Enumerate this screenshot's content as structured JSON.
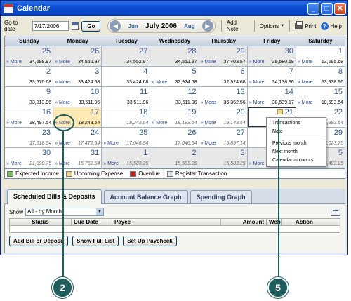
{
  "window": {
    "title": "Calendar",
    "controls": [
      "_",
      "□",
      "✕"
    ]
  },
  "toolbar": {
    "goto_label": "Go to date",
    "date_value": "7/17/2006",
    "go_label": "Go",
    "prev_month": "Jun",
    "current_month": "July 2006",
    "next_month": "Aug",
    "add_note": "Add Note",
    "options": "Options",
    "print": "Print",
    "help": "Help"
  },
  "calendar": {
    "weekdays": [
      "Sunday",
      "Monday",
      "Tuesday",
      "Wednesday",
      "Thursday",
      "Friday",
      "Saturday"
    ],
    "more_label": "» More",
    "weeks": [
      [
        {
          "day": "25",
          "more": true,
          "balance": "34,698.97",
          "other": true
        },
        {
          "day": "26",
          "more": true,
          "balance": "34,552.97",
          "other": true
        },
        {
          "day": "27",
          "more": false,
          "balance": "34,552.97",
          "other": true
        },
        {
          "day": "28",
          "more": false,
          "balance": "34,552.97",
          "other": true
        },
        {
          "day": "29",
          "more": true,
          "balance": "37,403.57",
          "other": true
        },
        {
          "day": "30",
          "more": true,
          "balance": "39,580.18",
          "other": true
        },
        {
          "day": "1",
          "more": true,
          "balance": "13,695.68"
        }
      ],
      [
        {
          "day": "2",
          "more": false,
          "balance": "33,570.68"
        },
        {
          "day": "3",
          "more": true,
          "balance": "33,424.68"
        },
        {
          "day": "4",
          "more": false,
          "balance": "33,424.68"
        },
        {
          "day": "5",
          "more": true,
          "balance": "32,924.68"
        },
        {
          "day": "6",
          "more": false,
          "balance": "32,924.68"
        },
        {
          "day": "7",
          "more": true,
          "balance": "34,138.96"
        },
        {
          "day": "8",
          "more": true,
          "balance": "33,938.96"
        }
      ],
      [
        {
          "day": "9",
          "more": false,
          "balance": "33,813.96"
        },
        {
          "day": "10",
          "more": true,
          "balance": "33,511.96"
        },
        {
          "day": "11",
          "more": false,
          "balance": "33,511.96"
        },
        {
          "day": "12",
          "more": false,
          "balance": "33,511.96"
        },
        {
          "day": "13",
          "more": true,
          "balance": "36,362.56"
        },
        {
          "day": "14",
          "more": true,
          "balance": "38,539.17"
        },
        {
          "day": "15",
          "more": true,
          "balance": "18,593.54"
        }
      ],
      [
        {
          "day": "16",
          "more": true,
          "balance": "18,497.54"
        },
        {
          "day": "17",
          "more": true,
          "balance": "18,243.54",
          "today": true
        },
        {
          "day": "18",
          "more": false,
          "balance": "18,243.54",
          "projected": true
        },
        {
          "day": "19",
          "more": true,
          "balance": "18,193.54",
          "projected": true
        },
        {
          "day": "20",
          "more": true,
          "balance": "18,143.54",
          "projected": true
        },
        {
          "day": "21",
          "more": false,
          "balance": "",
          "selected": true
        },
        {
          "day": "22",
          "more": false,
          "balance": "17,993.54",
          "projected": true
        }
      ],
      [
        {
          "day": "23",
          "more": false,
          "balance": "17,618.54",
          "projected": true
        },
        {
          "day": "24",
          "more": true,
          "balance": "17,472.54",
          "projected": true
        },
        {
          "day": "25",
          "more": true,
          "balance": "17,046.54",
          "projected": true
        },
        {
          "day": "26",
          "more": false,
          "balance": "17,046.54",
          "projected": true
        },
        {
          "day": "27",
          "more": true,
          "balance": "19,897.14",
          "projected": true
        },
        {
          "day": "28",
          "more": false,
          "balance": "",
          "projected": true
        },
        {
          "day": "29",
          "more": false,
          "balance": "22,023.75",
          "projected": true
        }
      ],
      [
        {
          "day": "30",
          "more": true,
          "balance": "21,898.75",
          "projected": true
        },
        {
          "day": "31",
          "more": true,
          "balance": "15,752.54",
          "projected": true
        },
        {
          "day": "1",
          "more": true,
          "balance": "15,583.25",
          "projected": true,
          "other": true
        },
        {
          "day": "2",
          "more": false,
          "balance": "15,583.25",
          "projected": true,
          "other": true
        },
        {
          "day": "3",
          "more": false,
          "balance": "15,583.25",
          "projected": true,
          "other": true
        },
        {
          "day": "4",
          "more": true,
          "balance": "13,233.25",
          "projected": true,
          "other": true
        },
        {
          "day": "5",
          "more": false,
          "balance": "15,483.25",
          "projected": true,
          "other": true
        }
      ]
    ]
  },
  "legend": [
    {
      "label": "Expected Income",
      "color": "#7cbc5a"
    },
    {
      "label": "Upcoming Expense",
      "color": "#f3d58a"
    },
    {
      "label": "Overdue",
      "color": "#c42020"
    },
    {
      "label": "Register Transaction",
      "color": "#e3e8f2"
    }
  ],
  "context_menu": {
    "items": [
      "Transactions",
      "Note"
    ],
    "items2": [
      "Previous month",
      "Next month",
      "Calendar accounts"
    ]
  },
  "tabs": [
    "Scheduled Bills & Deposits",
    "Account Balance Graph",
    "Spending Graph"
  ],
  "bills": {
    "show_label": "Show",
    "show_value": "All - by Month",
    "columns": [
      "Status",
      "Due Date",
      "Payee",
      "Amount",
      "Web",
      "Action"
    ],
    "buttons": [
      "Add Bill or Deposit",
      "Show Full List",
      "Set Up Paycheck"
    ]
  },
  "callouts": [
    "2",
    "5"
  ]
}
